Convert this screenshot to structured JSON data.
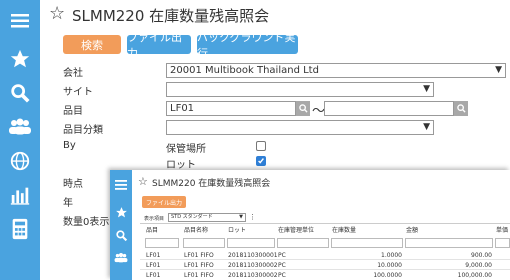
{
  "main": {
    "title": "SLMM220 在庫数量残高照会",
    "buttons": {
      "search": "検索",
      "file_output": "ファイル出力",
      "background_run": "バックグラウンド実行"
    },
    "labels": {
      "company": "会社",
      "site": "サイト",
      "item": "品目",
      "item_category": "品目分類",
      "by": "By",
      "point_in_time": "時点",
      "year": "年",
      "zero_qty": "数量0表示"
    },
    "company_value": "20001 Multibook Thailand Ltd",
    "item_from": "LF01",
    "range_sep": "～",
    "by_options": [
      {
        "label": "保管場所",
        "checked": false
      },
      {
        "label": "ロット",
        "checked": true
      }
    ]
  },
  "overlay": {
    "title": "SLMM220 在庫数量残高照会",
    "file_output": "ファイル出力",
    "display_item_label": "表示項目",
    "display_item_value": "STD スタンダード",
    "columns": [
      "品目",
      "品目名称",
      "ロット",
      "在庫管理単位",
      "在庫数量",
      "金額",
      "単価"
    ],
    "rows": [
      [
        "LF01",
        "LF01 FIFO",
        "2018110300001",
        "PC",
        "1.0000",
        "900.00",
        ""
      ],
      [
        "LF01",
        "LF01 FIFO",
        "2018110300002",
        "PC",
        "10.0000",
        "9,000.00",
        ""
      ],
      [
        "LF01",
        "LF01 FIFO",
        "2018110300002",
        "PC",
        "100.0000",
        "100,000.00",
        ""
      ]
    ]
  },
  "colors": {
    "sidebar": "#4aa3df",
    "orange_button": "#f29c5a",
    "blue_button": "#4aa3df",
    "checkbox_on": "#2f7fd6"
  }
}
